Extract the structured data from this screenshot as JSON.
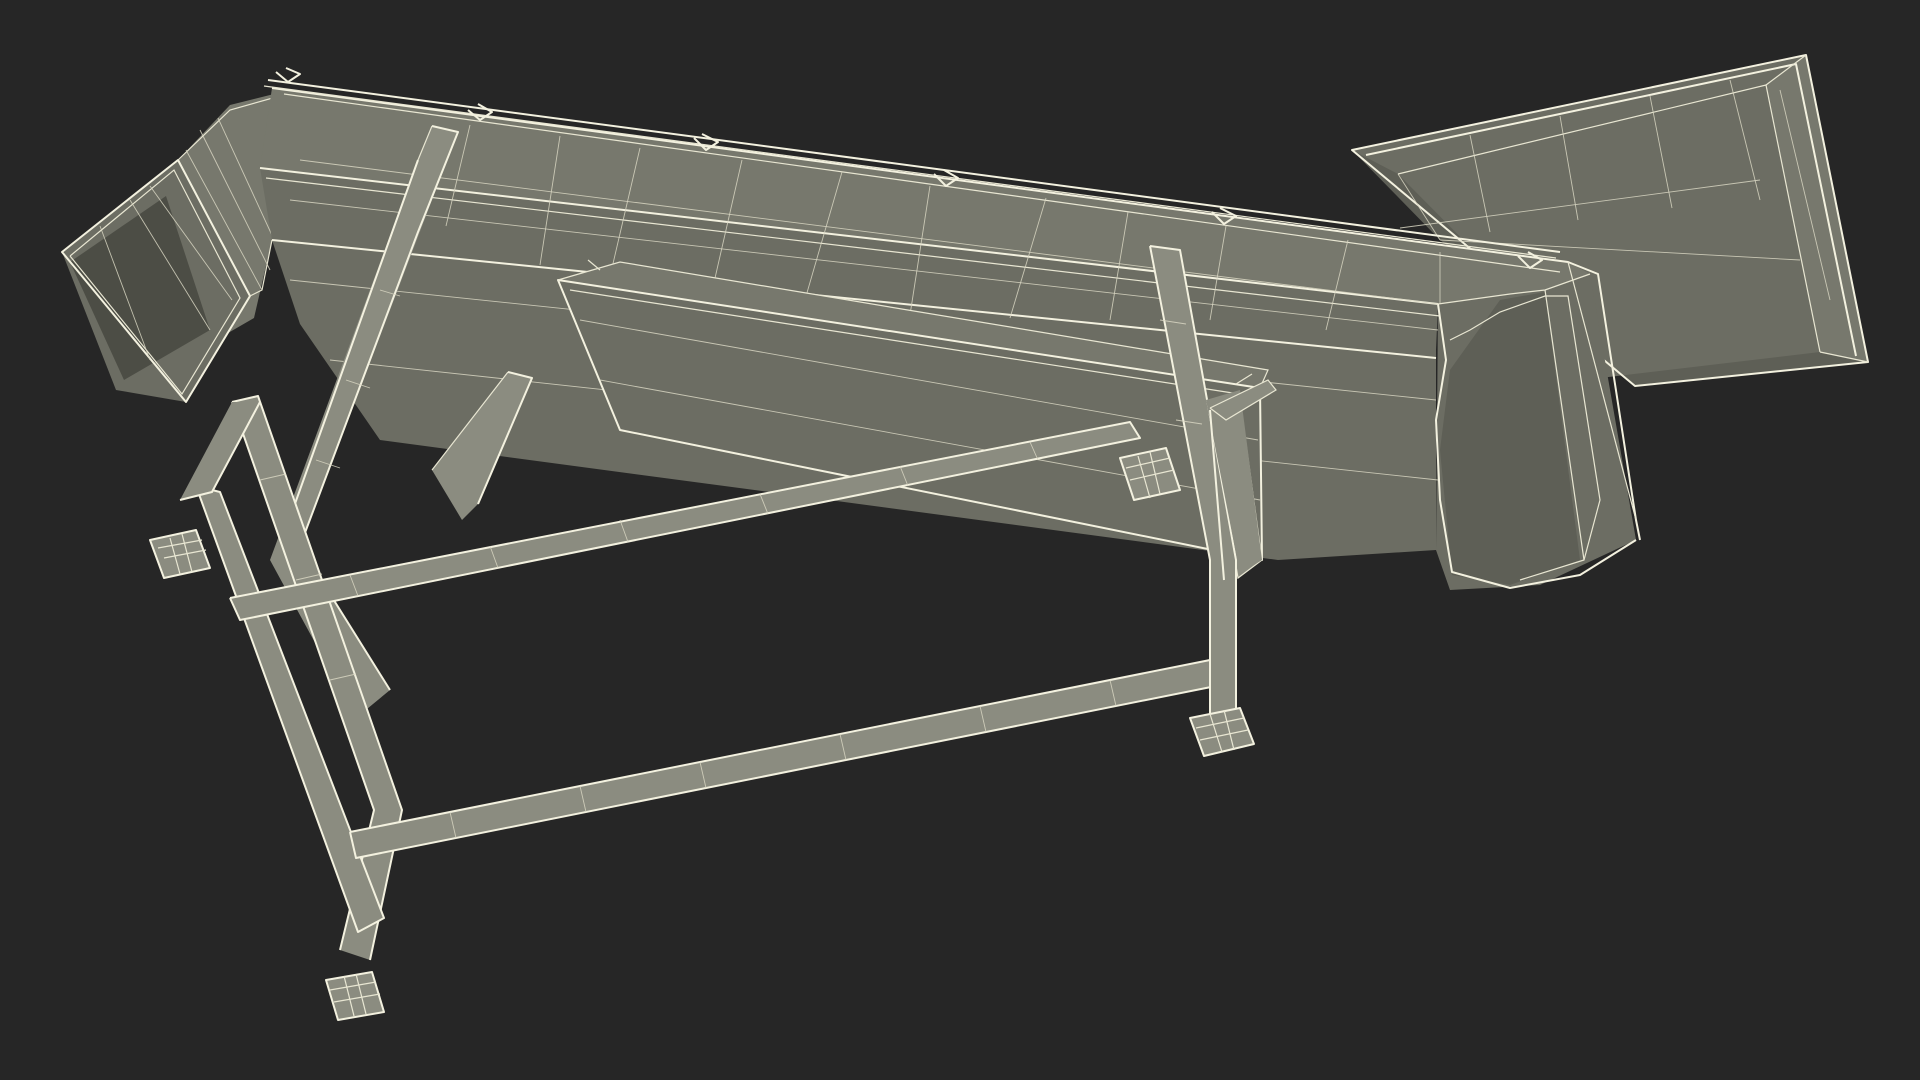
{
  "scene": {
    "background_color": "#262626",
    "mesh_face_color": "#6f7066",
    "wire_color": "#f3f1df"
  }
}
